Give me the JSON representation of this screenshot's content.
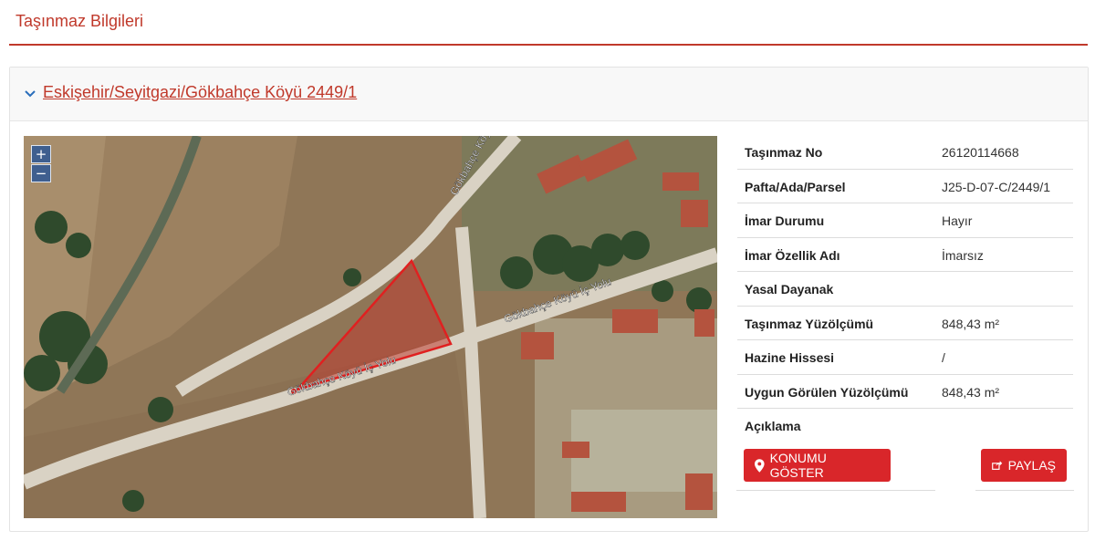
{
  "page": {
    "title": "Taşınmaz Bilgileri"
  },
  "panel": {
    "heading": "Eskişehir/Seyitgazi/Gökbahçe Köyü 2449/1"
  },
  "map": {
    "zoom_in": "+",
    "zoom_out": "−",
    "road_labels": [
      "Gökbahçe Köyü",
      "Gökbahçe Köyü İç Yolu",
      "Gökbahçe Köyü İç Yolu"
    ]
  },
  "details": [
    {
      "key": "Taşınmaz No",
      "value": "26120114668"
    },
    {
      "key": "Pafta/Ada/Parsel",
      "value": "J25-D-07-C/2449/1"
    },
    {
      "key": "İmar Durumu",
      "value": "Hayır"
    },
    {
      "key": "İmar Özellik Adı",
      "value": "İmarsız"
    },
    {
      "key": "Yasal Dayanak",
      "value": ""
    },
    {
      "key": "Taşınmaz Yüzölçümü",
      "value": "848,43 m²"
    },
    {
      "key": "Hazine Hissesi",
      "value": "/"
    },
    {
      "key": "Uygun Görülen Yüzölçümü",
      "value": "848,43 m²"
    },
    {
      "key": "Açıklama",
      "value": ""
    }
  ],
  "buttons": {
    "show_location": "KONUMU GÖSTER",
    "share": "PAYLAŞ"
  },
  "colors": {
    "accent": "#c0392b",
    "button": "#d9262a",
    "parcel_outline": "#e02020"
  },
  "icons": {
    "chevron": "chevron-down-icon",
    "location": "map-marker-icon",
    "share": "share-icon"
  }
}
